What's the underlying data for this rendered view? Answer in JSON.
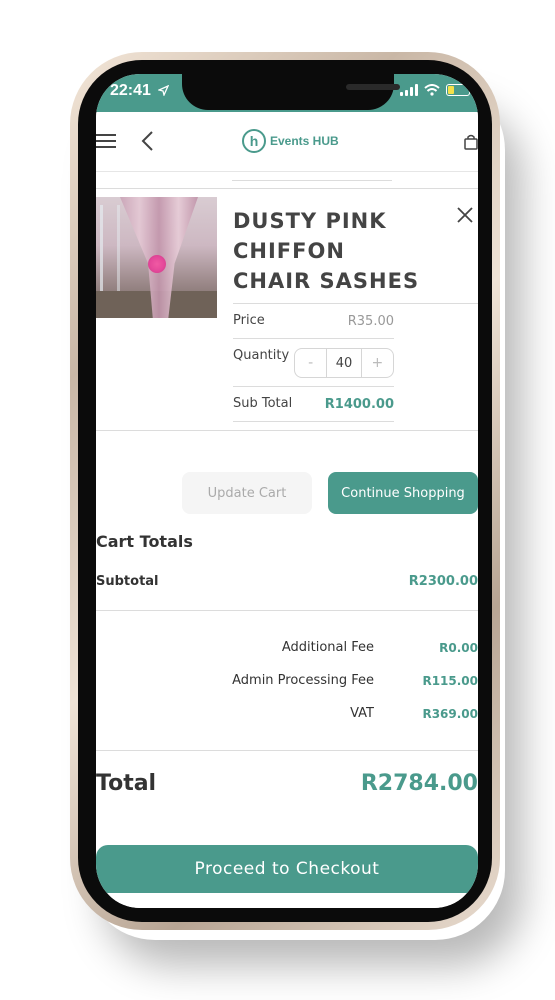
{
  "status": {
    "time": "22:41"
  },
  "header": {
    "logo_text": "Events HUB",
    "logo_letter": "h"
  },
  "product": {
    "title": "DUSTY PINK CHIFFON CHAIR SASHES",
    "price_label": "Price",
    "price_value": "R35.00",
    "quantity_label": "Quantity",
    "quantity_value": "40",
    "qty_minus": "-",
    "qty_plus": "+",
    "subtotal_label": "Sub Total",
    "subtotal_value": "R1400.00"
  },
  "actions": {
    "update_cart": "Update Cart",
    "continue_shopping": "Continue Shopping"
  },
  "totals": {
    "heading": "Cart Totals",
    "subtotal_label": "Subtotal",
    "subtotal_value": "R2300.00",
    "fees": [
      {
        "label": "Additional Fee",
        "value": "R0.00"
      },
      {
        "label": "Admin Processing Fee",
        "value": "R115.00"
      },
      {
        "label": "VAT",
        "value": "R369.00"
      }
    ],
    "total_label": "Total",
    "total_value": "R2784.00"
  },
  "checkout": {
    "label": "Proceed to Checkout"
  },
  "colors": {
    "accent": "#4a9a8c",
    "battery": "#f4e14a"
  },
  "icons": [
    "menu-icon",
    "back-arrow-icon",
    "shopping-bag-icon",
    "close-icon",
    "location-arrow-icon",
    "signal-icon",
    "wifi-icon",
    "battery-icon"
  ]
}
